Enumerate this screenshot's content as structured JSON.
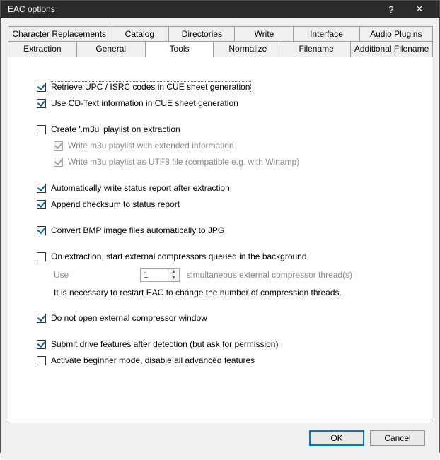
{
  "window": {
    "title": "EAC options",
    "help": "?",
    "close": "✕"
  },
  "tabs_row1": {
    "t0": "Character Replacements",
    "t1": "Catalog",
    "t2": "Directories",
    "t3": "Write",
    "t4": "Interface",
    "t5": "Audio Plugins"
  },
  "tabs_row2": {
    "t0": "Extraction",
    "t1": "General",
    "t2": "Tools",
    "t3": "Normalize",
    "t4": "Filename",
    "t5": "Additional Filename"
  },
  "options": {
    "retrieve_upc": {
      "label": "Retrieve UPC / ISRC codes in CUE sheet generation",
      "checked": true
    },
    "use_cdtext": {
      "label": "Use CD-Text information in CUE sheet generation",
      "checked": true
    },
    "create_m3u": {
      "label": "Create '.m3u' playlist on extraction",
      "checked": false
    },
    "m3u_extended": {
      "label": "Write m3u playlist with extended information",
      "checked": true,
      "disabled": true
    },
    "m3u_utf8": {
      "label": "Write m3u playlist as UTF8 file (compatible e.g. with Winamp)",
      "checked": true,
      "disabled": true
    },
    "auto_status": {
      "label": "Automatically write status report after extraction",
      "checked": true
    },
    "append_checksum": {
      "label": "Append checksum to status report",
      "checked": true
    },
    "convert_bmp": {
      "label": "Convert BMP image files automatically to JPG",
      "checked": true
    },
    "ext_queue": {
      "label": "On extraction, start external compressors queued in the background",
      "checked": false
    },
    "threads": {
      "pre": "Use",
      "value": "1",
      "post": "simultaneous external compressor thread(s)"
    },
    "restart_note": "It is necessary to restart EAC to change the number of compression threads.",
    "no_ext_window": {
      "label": "Do not open external compressor window",
      "checked": true
    },
    "submit_drive": {
      "label": "Submit drive features after detection (but ask for permission)",
      "checked": true
    },
    "beginner_mode": {
      "label": "Activate beginner mode, disable all advanced features",
      "checked": false
    }
  },
  "buttons": {
    "ok": "OK",
    "cancel": "Cancel"
  }
}
